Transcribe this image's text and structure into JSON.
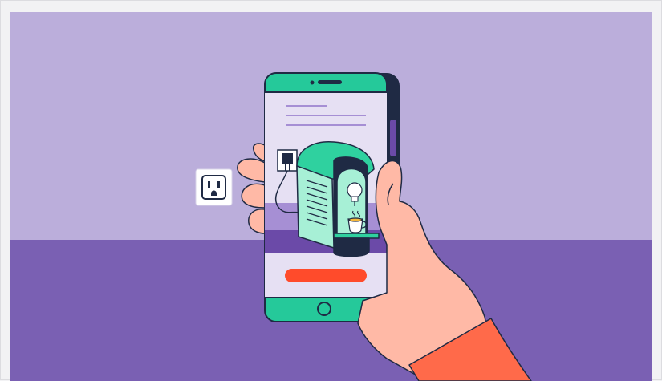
{
  "illustration": {
    "colors": {
      "wall": "#bbaedb",
      "floor": "#7a60b3",
      "phone_body": "#1f2a44",
      "phone_accent": "#25c99a",
      "screen_bg": "#e6e0f3",
      "screen_band": "#6b4aa8",
      "cta_button": "#ff4b2b",
      "skin": "#ffb9a6",
      "sleeve": "#ff6a4a",
      "outline": "#1f2a44",
      "machine": "#2fd19f",
      "machine_light": "#a7f0d6",
      "outlet_bg": "#ffffff"
    },
    "icons": [
      "wall-outlet-icon",
      "light-bulb-icon",
      "coffee-cup-icon",
      "home-button-icon",
      "plug-icon"
    ]
  }
}
